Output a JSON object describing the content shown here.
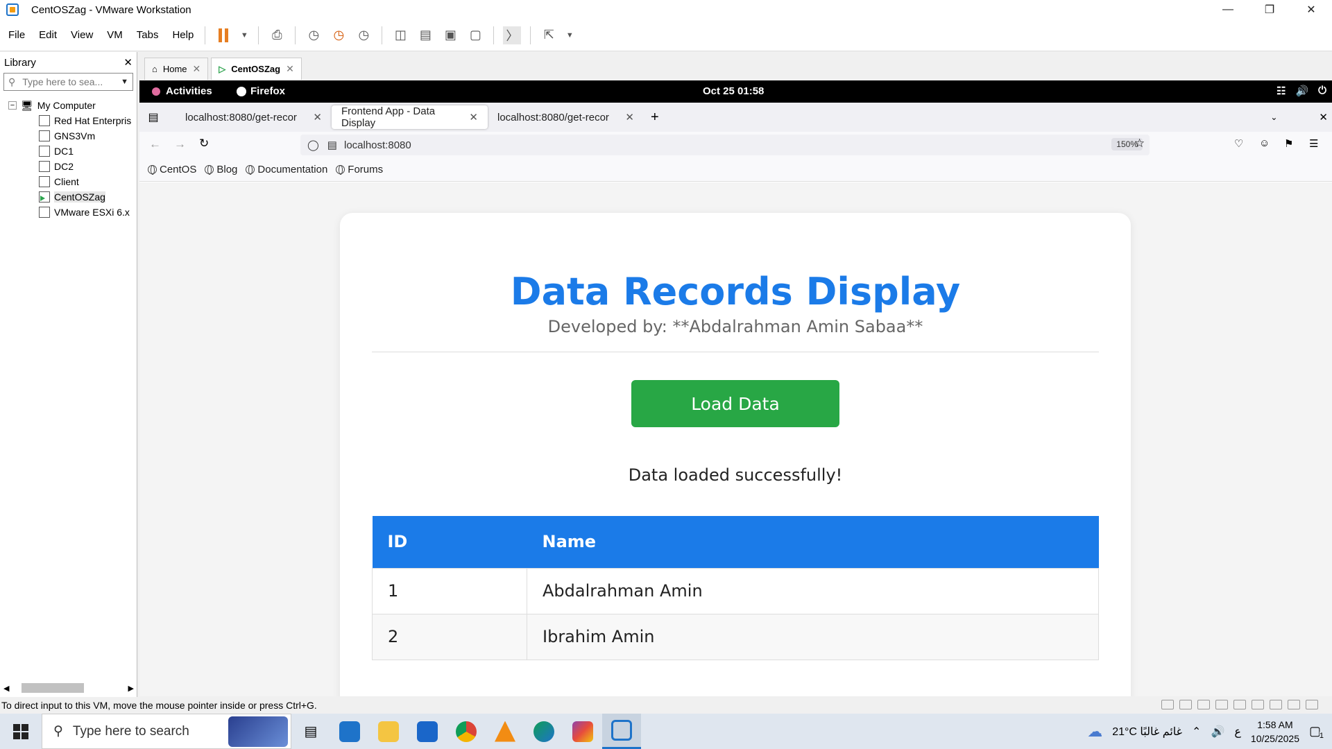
{
  "window": {
    "title": "CentOSZag - VMware Workstation"
  },
  "menu": [
    "File",
    "Edit",
    "View",
    "VM",
    "Tabs",
    "Help"
  ],
  "library": {
    "title": "Library",
    "search_placeholder": "Type here to sea...",
    "root": "My Computer",
    "items": [
      "Red Hat Enterpris",
      "GNS3Vm",
      "DC1",
      "DC2",
      "Client",
      "CentOSZag",
      "VMware ESXi 6.x"
    ],
    "selected": "CentOSZag"
  },
  "vm_tabs": [
    {
      "label": "Home"
    },
    {
      "label": "CentOSZag"
    }
  ],
  "gnome": {
    "activities": "Activities",
    "app": "Firefox",
    "clock": "Oct 25  01:58"
  },
  "browser": {
    "tabs": [
      {
        "label": "localhost:8080/get-recor"
      },
      {
        "label": "Frontend App - Data Display"
      },
      {
        "label": "localhost:8080/get-recor"
      }
    ],
    "url": "localhost:8080",
    "zoom": "150%",
    "bookmarks": [
      "CentOS",
      "Blog",
      "Documentation",
      "Forums"
    ]
  },
  "page": {
    "title": "Data Records Display",
    "subtitle": "Developed by: **Abdalrahman Amin Sabaa**",
    "button": "Load Data",
    "status": "Data loaded successfully!",
    "table": {
      "headers": [
        "ID",
        "Name"
      ],
      "rows": [
        [
          "1",
          "Abdalrahman Amin"
        ],
        [
          "2",
          "Ibrahim Amin"
        ]
      ]
    }
  },
  "statusbar": {
    "text": "To direct input to this VM, move the mouse pointer inside or press Ctrl+G."
  },
  "taskbar": {
    "search_placeholder": "Type here to search",
    "weather": "21°C  غائم غالبًا",
    "lang": "ع",
    "time": "1:58 AM",
    "date": "10/25/2025",
    "notif_count": "1"
  },
  "colors": {
    "accent": "#1b7be8",
    "button": "#28a745"
  }
}
